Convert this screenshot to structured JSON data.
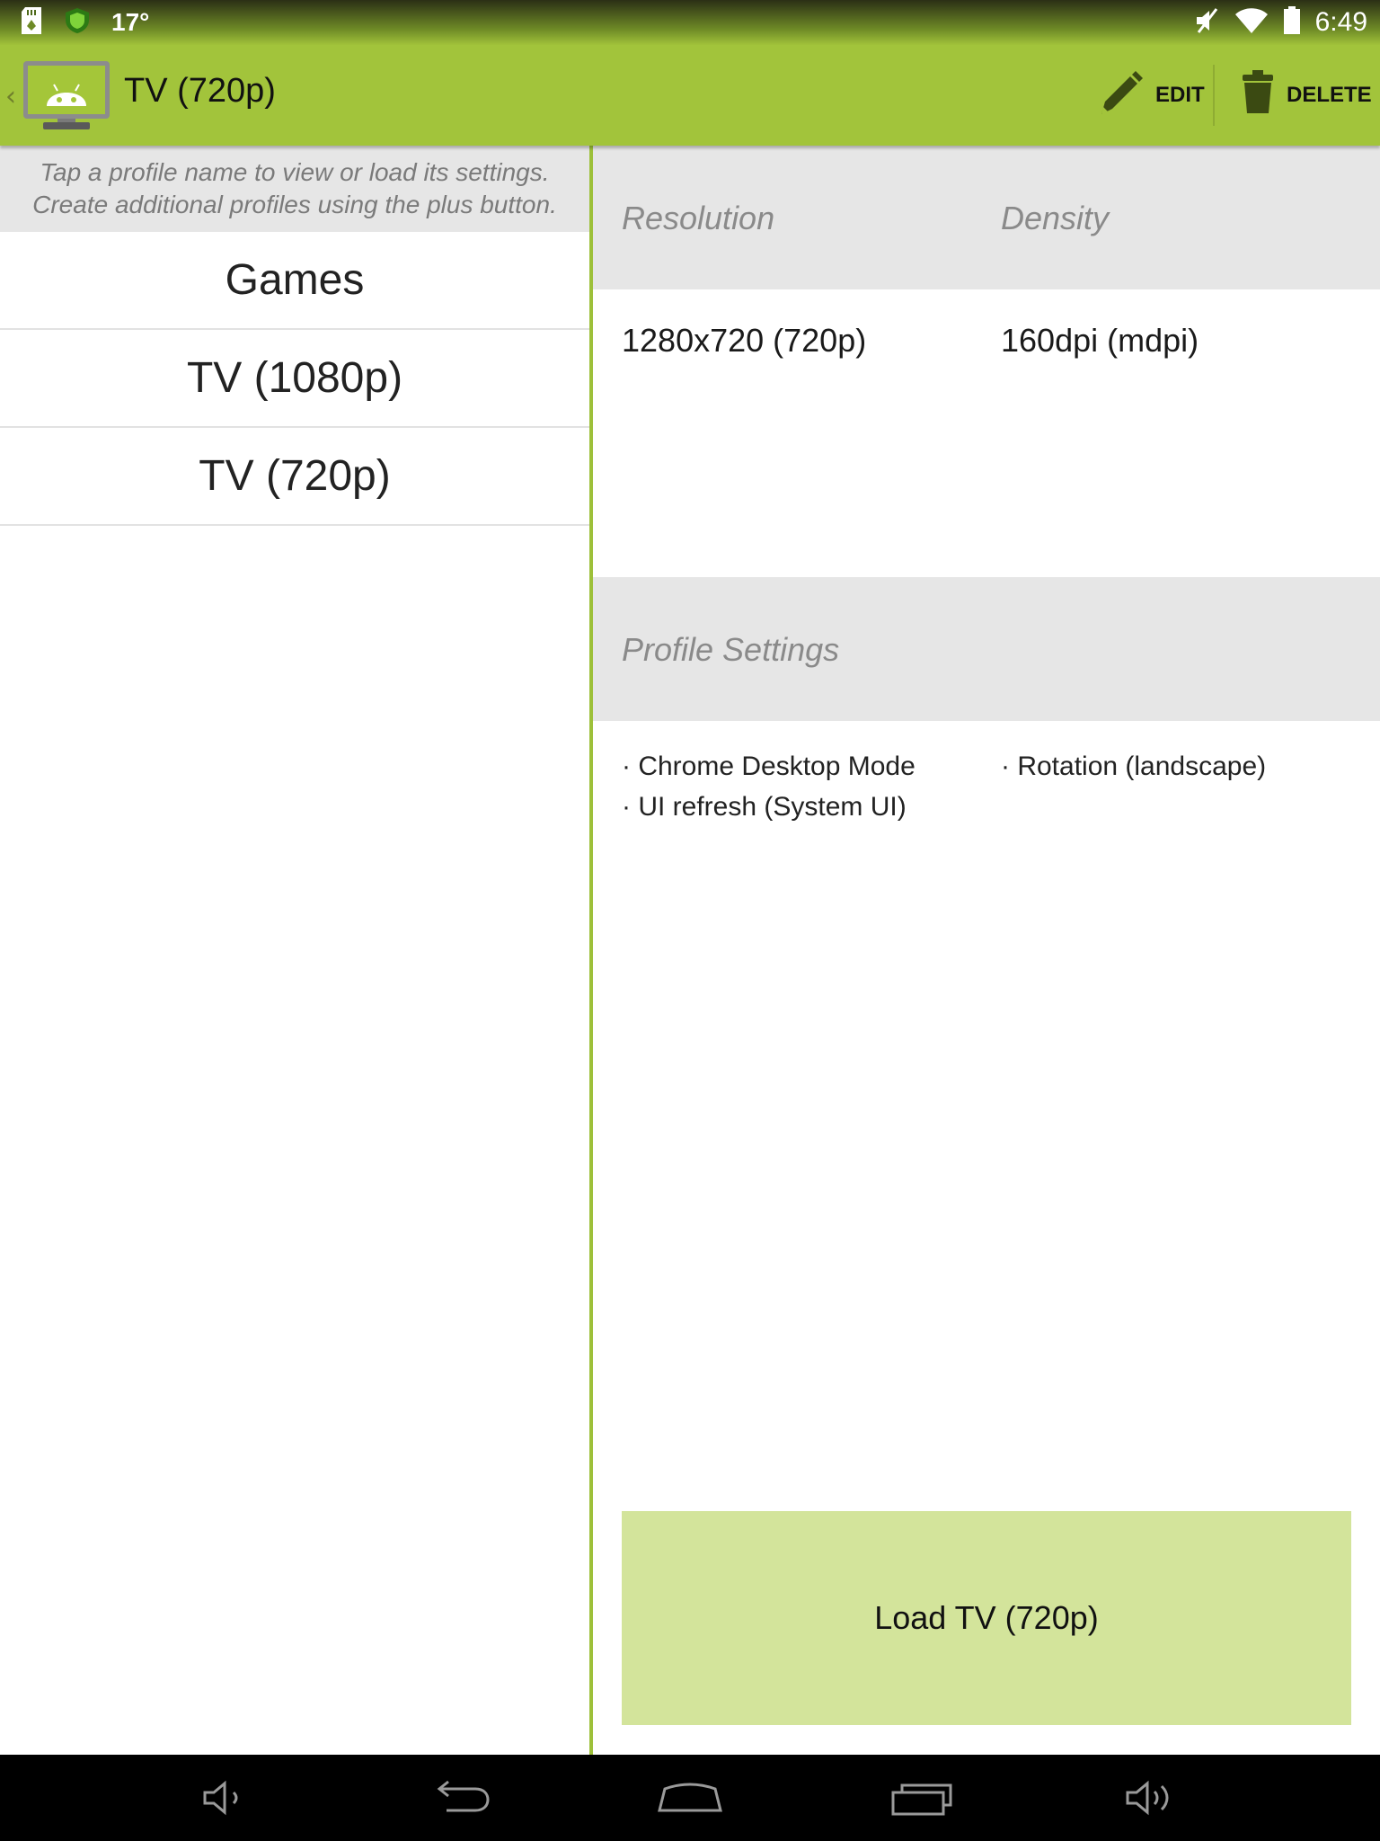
{
  "status_bar": {
    "temperature": "17°",
    "time": "6:49",
    "icons": [
      "sd-card-icon",
      "shield-icon",
      "muted-icon",
      "wifi-icon",
      "battery-icon"
    ]
  },
  "action_bar": {
    "title": "TV (720p)",
    "edit_label": "EDIT",
    "delete_label": "DELETE",
    "accent_color": "#a2c43b"
  },
  "left_pane": {
    "hint_line1": "Tap a profile name to view or load its settings.",
    "hint_line2": "Create additional profiles using the plus button.",
    "profiles": [
      {
        "label": "Games"
      },
      {
        "label": "TV (1080p)"
      },
      {
        "label": "TV (720p)"
      }
    ]
  },
  "detail": {
    "resolution_header": "Resolution",
    "density_header": "Density",
    "resolution_value": "1280x720 (720p)",
    "density_value": "160dpi (mdpi)",
    "profile_settings_header": "Profile Settings",
    "settings": [
      "· Chrome Desktop Mode",
      "· Rotation (landscape)",
      "· UI refresh (System UI)"
    ],
    "load_button_label": "Load TV (720p)",
    "load_button_color": "#d3e49b"
  },
  "nav_bar": {
    "buttons": [
      "volume-down-icon",
      "back-icon",
      "home-icon",
      "recent-apps-icon",
      "volume-up-icon"
    ]
  }
}
